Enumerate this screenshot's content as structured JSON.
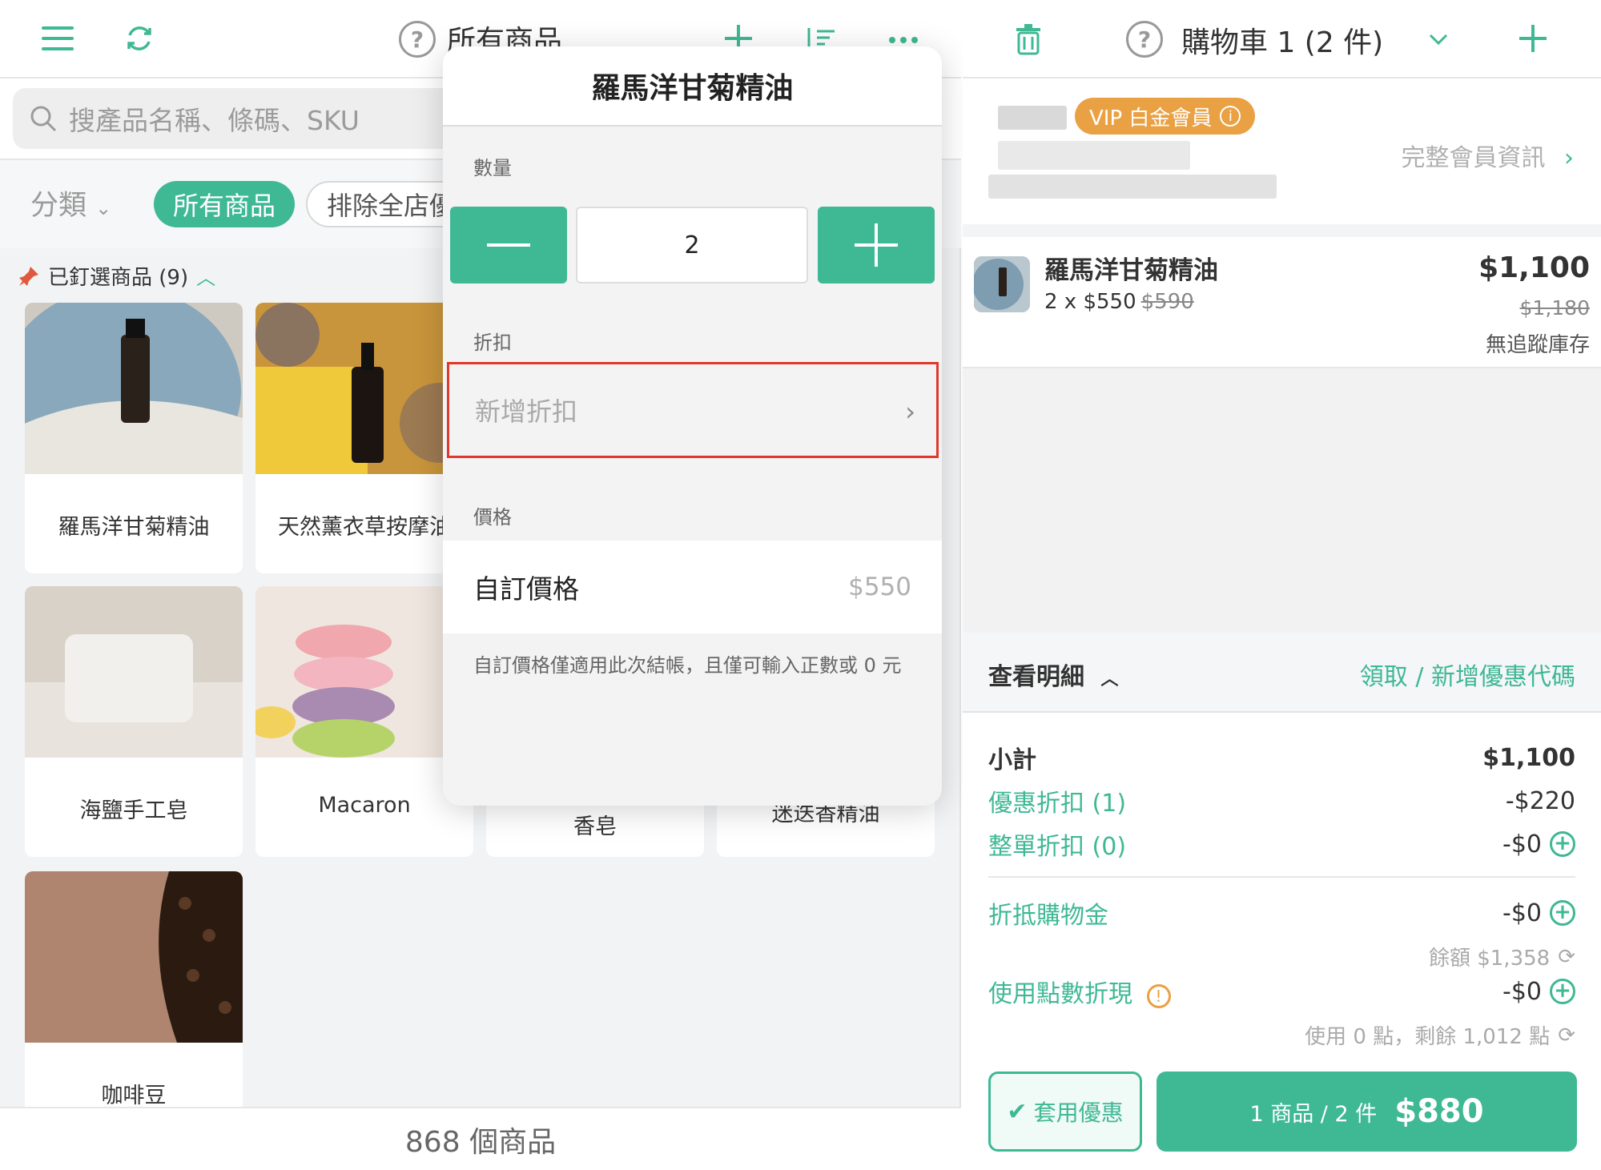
{
  "left": {
    "title": "所有商品",
    "search_placeholder": "搜產品名稱、條碼、SKU",
    "category_label": "分類",
    "filter_active": "所有商品",
    "filter_other": "排除全店優惠",
    "pinned_label": "已釘選商品 (9)",
    "products": [
      {
        "name": "羅馬洋甘菊精油"
      },
      {
        "name": "天然薰衣草按摩油"
      },
      {
        "name": "海鹽手工皂"
      },
      {
        "name": "Macaron"
      },
      {
        "name": "香皂"
      },
      {
        "name": "迷迭香精油"
      },
      {
        "name": "咖啡豆"
      }
    ],
    "footer": "868 個商品"
  },
  "popover": {
    "title": "羅馬洋甘菊精油",
    "qty_label": "數量",
    "qty_value": "2",
    "minus_symbol": "—",
    "plus_symbol": "+",
    "discount_label": "折扣",
    "add_discount": "新增折扣",
    "price_label": "價格",
    "custom_price_label": "自訂價格",
    "custom_price_placeholder": "$550",
    "note": "自訂價格僅適用此次結帳，且僅可輸入正數或 0 元"
  },
  "right": {
    "cart_title": "購物車 1 (2 件)",
    "vip_badge": "VIP 白金會員",
    "full_member_info": "完整會員資訊",
    "item": {
      "name": "羅馬洋甘菊精油",
      "qty_text": "2 x $550",
      "orig_unit": "$590",
      "total": "$1,100",
      "orig_total": "$1,180",
      "stock": "無追蹤庫存"
    },
    "details_label": "查看明細",
    "coupon_link": "領取 / 新增優惠代碼",
    "subtotal_label": "小計",
    "subtotal_value": "$1,100",
    "promo_label": "優惠折扣 (1)",
    "promo_value": "-$220",
    "order_disc_label": "整單折扣 (0)",
    "order_disc_value": "-$0",
    "credit_label": "折抵購物金",
    "credit_value": "-$0",
    "credit_balance": "餘額 $1,358",
    "points_label": "使用點數折現",
    "points_value": "-$0",
    "points_note": "使用 0 點，剩餘 1,012 點",
    "apply_btn": "套用優惠",
    "checkout_summary": "1 商品 / 2 件",
    "checkout_total": "$880"
  },
  "colors": {
    "accent": "#3fb894",
    "vip": "#e9a144",
    "highlight": "#e0382a"
  }
}
